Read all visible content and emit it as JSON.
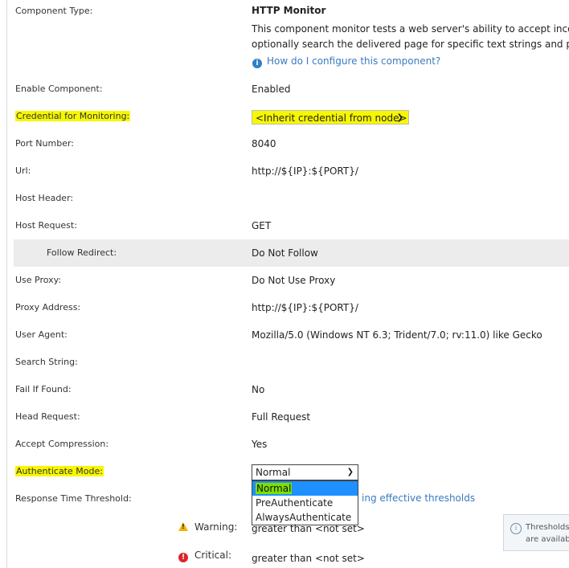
{
  "component": {
    "type_label": "Component Type:",
    "type_value": "HTTP Monitor",
    "desc_line1": "This component monitor tests a web server's ability to accept incoming",
    "desc_line2": "optionally search the delivered page for specific text strings and pass o",
    "help_link": "How do I configure this component?"
  },
  "fields": {
    "enable_label": "Enable Component:",
    "enable_value": "Enabled",
    "credential_label": "Credential for Monitoring:",
    "credential_value": "<Inherit credential from node>",
    "port_label": "Port Number:",
    "port_value": "8040",
    "url_label": "Url:",
    "url_value": "http://${IP}:${PORT}/",
    "host_header_label": "Host Header:",
    "host_request_label": "Host Request:",
    "host_request_value": "GET",
    "follow_redirect_label": "Follow Redirect:",
    "follow_redirect_value": "Do Not Follow",
    "use_proxy_label": "Use Proxy:",
    "use_proxy_value": "Do Not Use Proxy",
    "proxy_address_label": "Proxy Address:",
    "proxy_address_value": "http://${IP}:${PORT}/",
    "user_agent_label": "User Agent:",
    "user_agent_value": "Mozilla/5.0 (Windows NT 6.3; Trident/7.0; rv:11.0) like Gecko",
    "search_string_label": "Search String:",
    "fail_if_found_label": "Fail If Found:",
    "fail_if_found_value": "No",
    "head_request_label": "Head Request:",
    "head_request_value": "Full Request",
    "accept_compression_label": "Accept Compression:",
    "accept_compression_value": "Yes",
    "authenticate_label": "Authenticate Mode:",
    "authenticate_value": "Normal",
    "authenticate_options": [
      "Normal",
      "PreAuthenticate",
      "AlwaysAuthenticate"
    ],
    "response_time_label": "Response Time Threshold:",
    "effective_link": "ing effective thresholds",
    "warning_label": "Warning:",
    "warning_value": "greater than <not set>",
    "critical_label": "Critical:",
    "critical_value": "greater than <not set>",
    "tip_line1": "Thresholds",
    "tip_line2": "are availab"
  },
  "colors": {
    "highlight": "#f7f700",
    "link": "#3a7bbf",
    "selected_option": "#1e90ff",
    "warning": "#f2b300",
    "critical": "#d9262d"
  },
  "icons": [
    "info-icon",
    "chevron-down-icon",
    "warning-icon",
    "critical-icon"
  ]
}
